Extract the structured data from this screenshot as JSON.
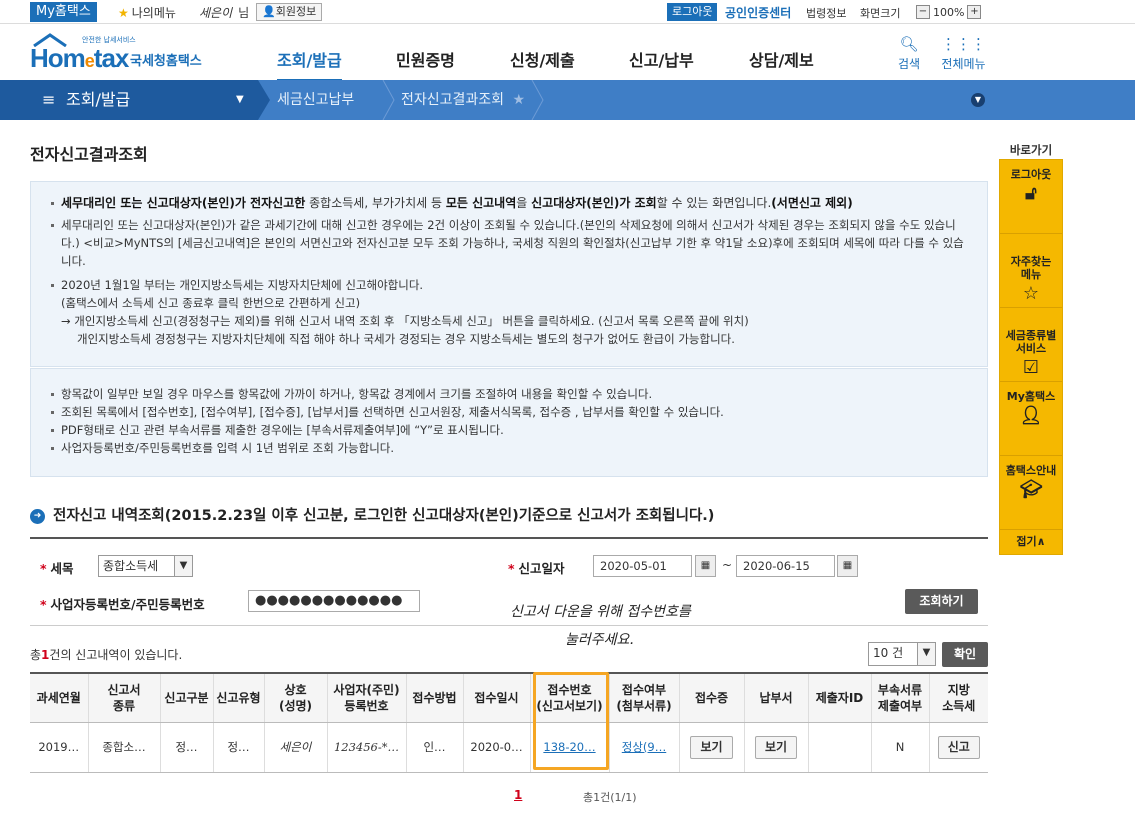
{
  "topbar": {
    "my_hometax": "My홈택스",
    "my_menu": "나의메뉴",
    "user_name": "세은이",
    "user_suffix": "님",
    "member_info": "회원정보",
    "logout": "로그아웃",
    "cert_center": "공인인증센터",
    "law_info": "법령정보",
    "screen_size": "화면크기",
    "zoom": "100%",
    "zoom_minus": "−",
    "zoom_plus": "+"
  },
  "header": {
    "logo_main": "Hom",
    "logo_e": "e",
    "logo_tail": "tax",
    "logo_tiny": "안전한 납세서비스",
    "logo_sub": "국세청홈택스",
    "nav": [
      "조회/발급",
      "민원증명",
      "신청/제출",
      "신고/납부",
      "상담/제보"
    ],
    "search": "검색",
    "all_menu": "전체메뉴",
    "search_icon": "search-icon",
    "grid_icon": "grid-icon"
  },
  "locbar": {
    "first": "조회/발급",
    "items": [
      "세금신고납부",
      "전자신고결과조회"
    ]
  },
  "page_title": "전자신고결과조회",
  "info1": {
    "l1_b1": "세무대리인 또는 신고대상자(본인)가 전자신고한",
    "l1_t1": " 종합소득세, 부가가치세 등 ",
    "l1_b2": "모든 신고내역",
    "l1_t2": "을 ",
    "l1_b3": "신고대상자(본인)가 조회",
    "l1_t3": "할 수 있는 화면입니다.",
    "l1_b4": "(서면신고 제외)",
    "l2": "세무대리인 또는 신고대상자(본인)가 같은 과세기간에 대해 신고한 경우에는 2건 이상이 조회될  수 있습니다.(본인의 삭제요청에 의해서 신고서가 삭제된 경우는 조회되지 않을 수도 있습니다.) <비교>MyNTS의 [세금신고내역]은 본인의 서면신고와 전자신고분 모두 조회 가능하나, 국세청 직원의 확인절차(신고납부 기한 후 약1달 소요)후에 조회되며 세목에 따라 다를 수 있습니다.",
    "l3a": "2020년 1월1일 부터는 개인지방소득세는 지방자치단체에 신고해야합니다.",
    "l3b": "(홈택스에서 소득세 신고 종료후 클릭 한번으로 간편하게 신고)",
    "l3c": "→ 개인지방소득세 신고(경정청구는 제외)를 위해 신고서 내역 조회 후 「지방소득세 신고」 버튼을 클릭하세요. (신고서 목록 오른쪽 끝에 위치)",
    "l3d": "개인지방소득세 경정청구는 지방자치단체에 직접 해야 하나 국세가 경정되는 경우 지방소득세는 별도의 청구가 없어도 환급이 가능합니다."
  },
  "info2": [
    "항목값이 일부만 보일 경우 마우스를 항목값에 가까이 하거나, 항목값 경계에서 크기를 조절하여 내용을 확인할 수 있습니다.",
    "조회된 목록에서 [접수번호], [접수여부], [접수증], [납부서]를 선택하면 신고서원장, 제출서식목록, 접수증 , 납부서를 확인할 수 있습니다.",
    "PDF형태로 신고 관련 부속서류를 제출한 경우에는 [부속서류제출여부]에 “Y”로  표시됩니다.",
    "사업자등록번호/주민등록번호를 입력 시 1년 범위로 조회 가능합니다."
  ],
  "section_title": "전자신고 내역조회(2015.2.23일 이후 신고분, 로그인한  신고대상자(본인)기준으로  신고서가 조회됩니다.)",
  "search": {
    "req": "*",
    "tax_label": "세목",
    "tax_value": "종합소득세",
    "date_label": "신고일자",
    "date_from": "2020-05-01",
    "date_to": "2020-06-15",
    "tilde": "~",
    "id_label": "사업자등록번호/주민등록번호",
    "id_value": "●●●●●●●●●●●●●",
    "search_btn": "조회하기"
  },
  "annotation": {
    "line1": "신고서 다운을 위해 접수번호를",
    "line2": "눌러주세요."
  },
  "result": {
    "total_prefix": "총",
    "total_count": "1",
    "total_suffix": "건의 신고내역이 있습니다.",
    "page_size": "10 건",
    "confirm_btn": "확인"
  },
  "table": {
    "headers": [
      [
        "과세연월",
        ""
      ],
      [
        "신고서",
        "종류"
      ],
      [
        "신고구분",
        ""
      ],
      [
        "신고유형",
        ""
      ],
      [
        "상호",
        "(성명)"
      ],
      [
        "사업자(주민)",
        "등록번호"
      ],
      [
        "접수방법",
        ""
      ],
      [
        "접수일시",
        ""
      ],
      [
        "접수번호",
        "(신고서보기)"
      ],
      [
        "접수여부",
        "(첨부서류)"
      ],
      [
        "접수증",
        ""
      ],
      [
        "납부서",
        ""
      ],
      [
        "제출자ID",
        ""
      ],
      [
        "부속서류",
        "제출여부"
      ],
      [
        "지방",
        "소득세"
      ]
    ],
    "row": {
      "period": "2019…",
      "form_type": "종합소…",
      "report_div": "정…",
      "report_type": "정…",
      "name": "세은이",
      "reg_no": "123456-*…",
      "method": "인…",
      "received_at": "2020-0…",
      "receipt_no": "138-20…",
      "status": "정상(9…",
      "receipt_btn": "보기",
      "payment_btn": "보기",
      "submitter_id": "",
      "attachment": "N",
      "local_tax_btn": "신고"
    }
  },
  "pager": {
    "page": "1",
    "info": "총1건(1/1)"
  },
  "quick": {
    "title": "바로가기",
    "items": [
      {
        "label": "로그아웃",
        "icon": "logout-icon"
      },
      {
        "label": "자주찾는\n메뉴",
        "icon": "star-icon"
      },
      {
        "label": "세금종류별\n서비스",
        "icon": "check-icon"
      },
      {
        "label": "My홈택스",
        "icon": "user-icon"
      },
      {
        "label": "홈택스안내",
        "icon": "info-icon"
      }
    ],
    "fold": "접기∧"
  },
  "colors": {
    "brand": "#1b6fb8",
    "locbar": "#3f7ec6",
    "locbar_dark": "#1e5a9e",
    "quick": "#f5b800",
    "highlight": "#f5a623",
    "required": "#d0021b"
  }
}
